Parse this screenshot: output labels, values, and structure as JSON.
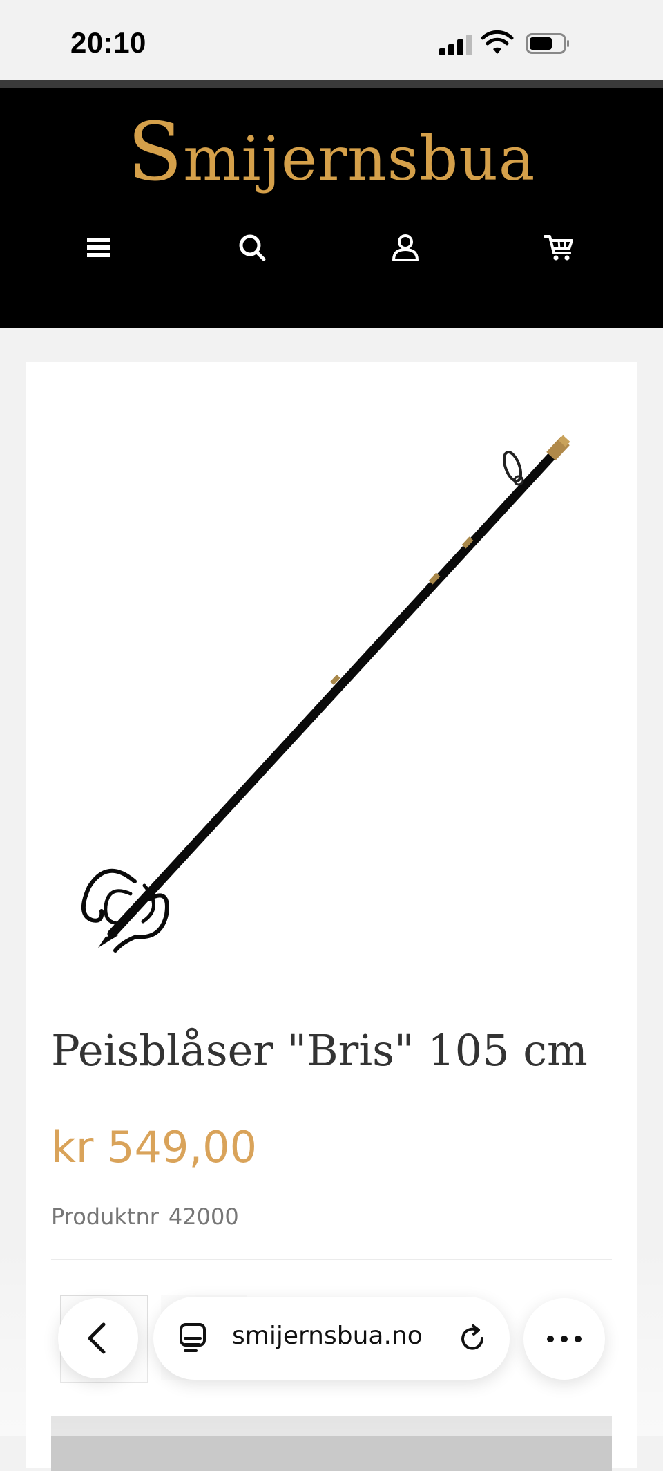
{
  "status_bar": {
    "time": "20:10",
    "icons": [
      "cellular-signal-icon",
      "wifi-icon",
      "battery-icon"
    ]
  },
  "header": {
    "logo_text_first": "S",
    "logo_text_rest": "mijernsbua",
    "nav": [
      "menu-icon",
      "search-icon",
      "account-icon",
      "cart-icon"
    ],
    "colors": {
      "background": "#000000",
      "logo": "#d5a04a"
    }
  },
  "product": {
    "title": "Peisblåser \"Bris\" 105 cm",
    "price": "kr 549,00",
    "sku_label": "Produktnr",
    "sku_value": "42000",
    "image_subject": "fireplace-bellows-rod-icon",
    "colors": {
      "price": "#d9a35a"
    }
  },
  "browser": {
    "url": "smijernsbua.no",
    "icons": [
      "back-icon",
      "page-menu-icon",
      "reload-icon",
      "more-icon"
    ]
  }
}
